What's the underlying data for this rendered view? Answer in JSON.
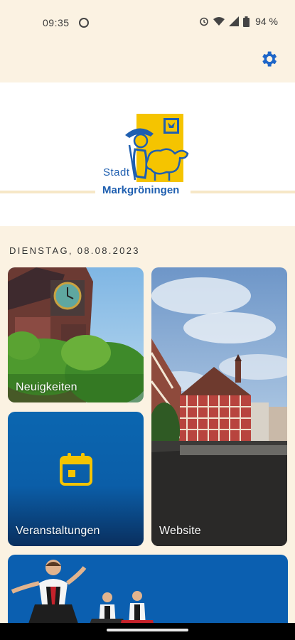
{
  "status_bar": {
    "time": "09:35",
    "battery_text": "94 %"
  },
  "header": {
    "settings_icon": "gear-icon"
  },
  "logo": {
    "line1": "Stadt",
    "line2": "Markgröningen",
    "colors": {
      "yellow": "#F5C400",
      "blue": "#1F5FB0"
    }
  },
  "date_label": "DIENSTAG, 08.08.2023",
  "tiles": {
    "news": {
      "label": "Neuigkeiten"
    },
    "events": {
      "label": "Veranstaltungen",
      "icon": "calendar-icon"
    },
    "website": {
      "label": "Website"
    }
  },
  "colors": {
    "background": "#FBF2E2",
    "tile_blue": "#0B5FB0",
    "accent_yellow": "#F5C400",
    "settings_blue": "#1E66C8"
  }
}
